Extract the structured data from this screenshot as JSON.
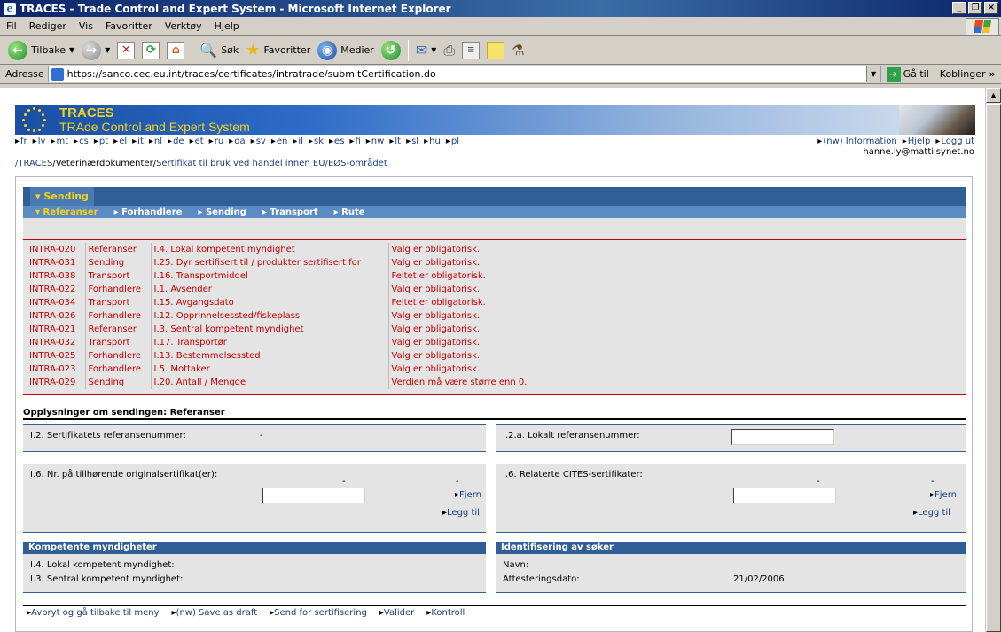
{
  "window": {
    "title": "TRACES - Trade Control and Expert System - Microsoft Internet Explorer"
  },
  "menu": [
    "Fil",
    "Rediger",
    "Vis",
    "Favoritter",
    "Verktøy",
    "Hjelp"
  ],
  "toolbar": {
    "back": "Tilbake",
    "search": "Søk",
    "favorites": "Favoritter",
    "media": "Medier"
  },
  "address": {
    "label": "Adresse",
    "url": "https://sanco.cec.eu.int/traces/certificates/intratrade/submitCertification.do",
    "go": "Gå til",
    "links": "Koblinger"
  },
  "banner": {
    "title": "TRACES",
    "subtitle": "TRAde Control and Expert System"
  },
  "languages": [
    "fr",
    "lv",
    "mt",
    "cs",
    "pt",
    "el",
    "it",
    "nl",
    "de",
    "et",
    "ru",
    "da",
    "sv",
    "en",
    "il",
    "sk",
    "es",
    "fi",
    "nw",
    "lt",
    "sl",
    "hu",
    "pl"
  ],
  "toplinks": [
    "(nw) Information",
    "Hjelp",
    "Logg ut"
  ],
  "user_email": "hanne.ly@mattilsynet.no",
  "breadcrumb": {
    "home": "/TRACES",
    "sep1": "/",
    "mid": "Veterinærdokumenter",
    "sep2": "/",
    "current": "Sertifikat til bruk ved handel innen EU/EØS-området"
  },
  "tabs_main": "Sending",
  "tabs_sub": [
    "Referanser",
    "Forhandlere",
    "Sending",
    "Transport",
    "Rute"
  ],
  "errors": [
    {
      "code": "INTRA-020",
      "section": "Referanser",
      "field": "I.4. Lokal kompetent myndighet",
      "msg": "Valg er obligatorisk."
    },
    {
      "code": "INTRA-031",
      "section": "Sending",
      "field": "I.25. Dyr sertifisert til / produkter sertifisert for",
      "msg": "Valg er obligatorisk."
    },
    {
      "code": "INTRA-038",
      "section": "Transport",
      "field": "I.16. Transportmiddel",
      "msg": "Feltet er obligatorisk."
    },
    {
      "code": "INTRA-022",
      "section": "Forhandlere",
      "field": "I.1. Avsender",
      "msg": "Valg er obligatorisk."
    },
    {
      "code": "INTRA-034",
      "section": "Transport",
      "field": "I.15. Avgangsdato",
      "msg": "Feltet er obligatorisk."
    },
    {
      "code": "INTRA-026",
      "section": "Forhandlere",
      "field": "I.12. Opprinnelsessted/fiskeplass",
      "msg": "Valg er obligatorisk."
    },
    {
      "code": "INTRA-021",
      "section": "Referanser",
      "field": "I.3. Sentral kompetent myndighet",
      "msg": "Valg er obligatorisk."
    },
    {
      "code": "INTRA-032",
      "section": "Transport",
      "field": "I.17. Transportør",
      "msg": "Valg er obligatorisk."
    },
    {
      "code": "INTRA-025",
      "section": "Forhandlere",
      "field": "I.13. Bestemmelsessted",
      "msg": "Valg er obligatorisk."
    },
    {
      "code": "INTRA-023",
      "section": "Forhandlere",
      "field": "I.5. Mottaker",
      "msg": "Valg er obligatorisk."
    },
    {
      "code": "INTRA-029",
      "section": "Sending",
      "field": "I.20. Antall / Mengde",
      "msg": "Verdien må være større enn 0."
    }
  ],
  "section_title": "Opplysninger om sendingen: Referanser",
  "form": {
    "cert_ref_label": "I.2. Sertifikatets referansenummer:",
    "cert_ref_value": "-",
    "local_ref_label": "I.2.a. Lokalt referansenummer:",
    "orig_cert_label": "I.6. Nr. på tillhørende originalsertifikat(er):",
    "cites_label": "I.6. Relaterte CITES-sertifikater:",
    "dash": "-",
    "remove": "Fjern",
    "add": "Legg til"
  },
  "authorities": {
    "header": "Kompetente myndigheter",
    "local": "I.4. Lokal kompetent myndighet:",
    "central": "I.3. Sentral kompetent myndighet:"
  },
  "applicant": {
    "header": "Identifisering av søker",
    "name_label": "Navn:",
    "date_label": "Attesteringsdato:",
    "date_value": "21/02/2006"
  },
  "actions": [
    "Avbryt og gå tilbake til meny",
    "(nw) Save as draft",
    "Send for sertifisering",
    "Valider",
    "Kontroll"
  ]
}
